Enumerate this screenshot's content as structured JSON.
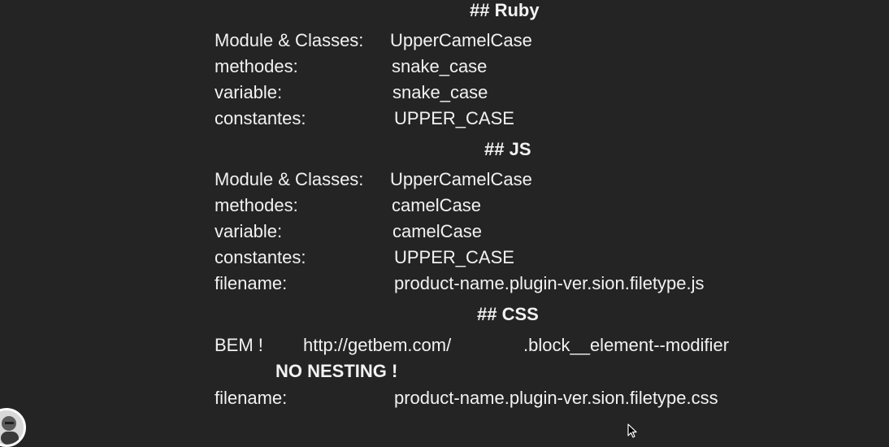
{
  "ruby": {
    "heading": "## Ruby",
    "rows": [
      {
        "label": "Module & Classes:",
        "value": "UpperCamelCase"
      },
      {
        "label": "methodes:",
        "value": "snake_case"
      },
      {
        "label": "variable:",
        "value": "snake_case"
      },
      {
        "label": "constantes:",
        "value": "UPPER_CASE"
      }
    ]
  },
  "js": {
    "heading": "## JS",
    "rows": [
      {
        "label": "Module & Classes:",
        "value": "UpperCamelCase"
      },
      {
        "label": "methodes:",
        "value": "camelCase"
      },
      {
        "label": "variable:",
        "value": "camelCase"
      },
      {
        "label": "constantes:",
        "value": "UPPER_CASE"
      },
      {
        "label": "filename:",
        "value": "product-name.plugin-ver.sion.filetype.js"
      }
    ]
  },
  "css": {
    "heading": "## CSS",
    "bem_label": "BEM !",
    "bem_url": "http://getbem.com/",
    "bem_pattern": ".block__element--modifier",
    "no_nesting": "NO NESTING !",
    "filename_label": "filename:",
    "filename_value": "product-name.plugin-ver.sion.filetype.css"
  },
  "icons": {
    "avatar": "presenter-avatar-icon",
    "cursor": "mouse-cursor-icon"
  }
}
